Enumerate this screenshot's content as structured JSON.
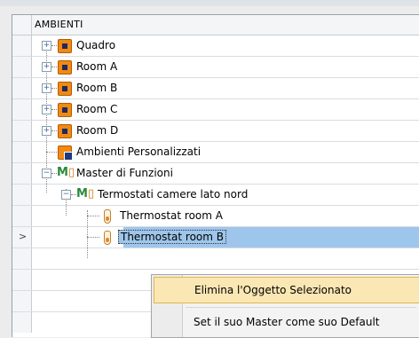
{
  "tree": {
    "header": "AMBIENTI",
    "nodes": [
      {
        "label": "Quadro",
        "icon": "room-icon"
      },
      {
        "label": "Room A",
        "icon": "room-icon"
      },
      {
        "label": "Room B",
        "icon": "room-icon"
      },
      {
        "label": "Room C",
        "icon": "room-icon"
      },
      {
        "label": "Room D",
        "icon": "room-icon"
      },
      {
        "label": "Ambienti Personalizzati",
        "icon": "custom-environment-icon"
      },
      {
        "label": "Master di Funzioni",
        "icon": "master-icon"
      },
      {
        "label": "Termostati camere lato nord",
        "icon": "master-icon"
      },
      {
        "label": "Thermostat room A",
        "icon": "thermostat-icon"
      },
      {
        "label": "Thermostat room B",
        "icon": "thermostat-icon",
        "selected": true
      }
    ],
    "row_indicator": ">"
  },
  "context_menu": {
    "items": [
      {
        "label": "Elimina l'Oggetto Selezionato",
        "highlighted": true
      },
      {
        "label": "Set il suo Master come suo Default",
        "highlighted": false
      }
    ]
  },
  "expanders": {
    "plus": "+",
    "minus": "−"
  },
  "colors": {
    "selection": "#9ec6ec",
    "room_icon": "#f08a14",
    "menu_highlight": "#fbe7b3"
  }
}
